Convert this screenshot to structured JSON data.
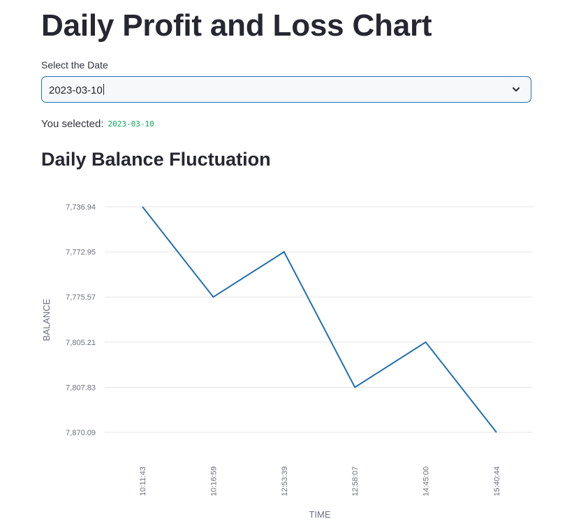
{
  "page": {
    "title": "Daily Profit and Loss Chart",
    "select_label": "Select the Date",
    "select_value": "2023-03-10",
    "selected_prefix": "You selected:",
    "selected_value": "2023-03-10",
    "chart_title": "Daily Balance Fluctuation"
  },
  "icons": {
    "dropdown": "chevron-down-icon"
  },
  "colors": {
    "line": "#1f6fb2",
    "accent_code": "#09a85a",
    "grid": "#e6e6e6",
    "focus_border": "#1f6fb2"
  },
  "chart_data": {
    "type": "line",
    "title": "Daily Balance Fluctuation",
    "xlabel": "TIME",
    "ylabel": "BALANCE",
    "y_axis_type": "category",
    "y_categories": [
      "7,736.94",
      "7,772.95",
      "7,775.57",
      "7,805.21",
      "7,807.83",
      "7,870.09"
    ],
    "categories": [
      "10:11:43",
      "10:16:59",
      "12:53:39",
      "12:58:07",
      "14:45:00",
      "15:40:44"
    ],
    "series": [
      {
        "values": [
          "7,736.94",
          "7,775.57",
          "7,772.95",
          "7,807.83",
          "7,805.21",
          "7,870.09"
        ]
      }
    ],
    "grid": true,
    "legend": "none"
  }
}
